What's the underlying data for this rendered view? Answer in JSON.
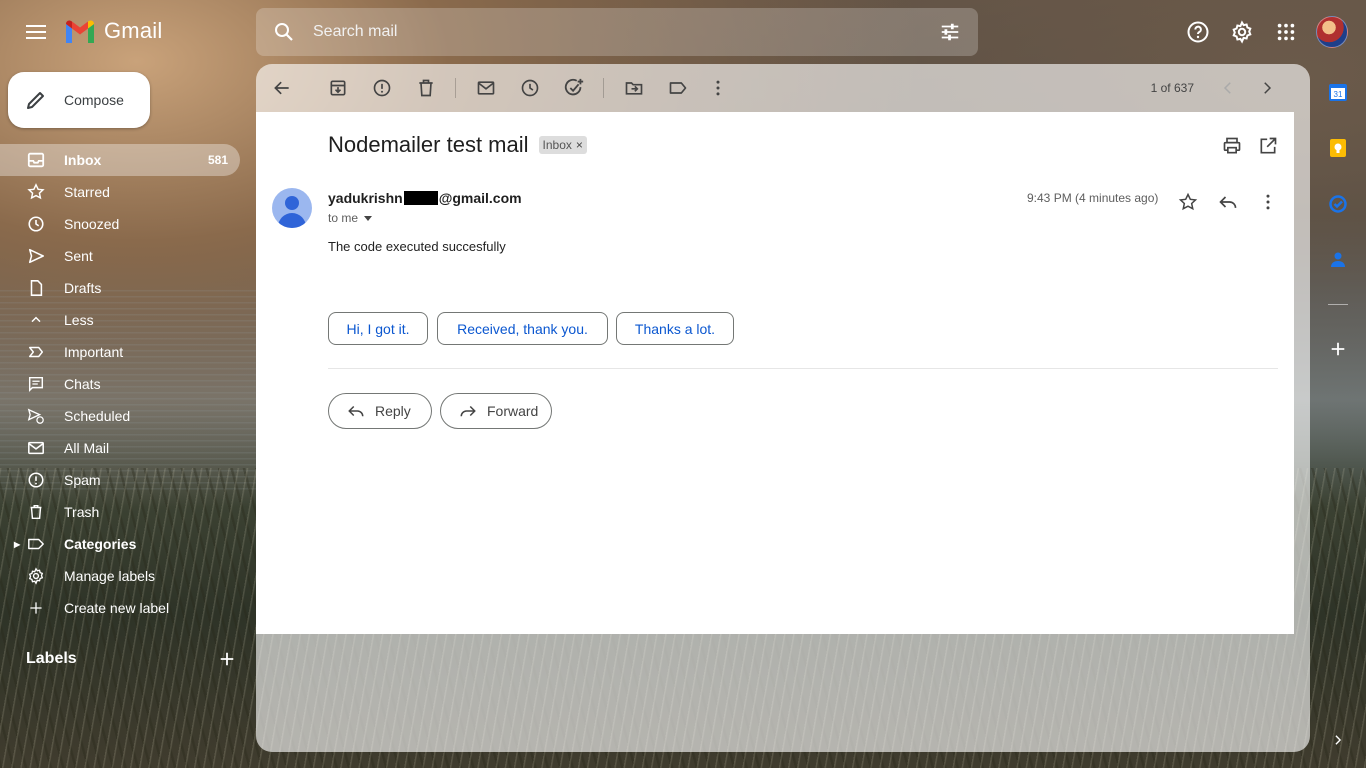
{
  "app": {
    "name": "Gmail"
  },
  "search": {
    "placeholder": "Search mail"
  },
  "sidebar": {
    "compose_label": "Compose",
    "items": [
      {
        "label": "Inbox",
        "count": "581"
      },
      {
        "label": "Starred"
      },
      {
        "label": "Snoozed"
      },
      {
        "label": "Sent"
      },
      {
        "label": "Drafts"
      },
      {
        "label": "Less"
      },
      {
        "label": "Important"
      },
      {
        "label": "Chats"
      },
      {
        "label": "Scheduled"
      },
      {
        "label": "All Mail"
      },
      {
        "label": "Spam"
      },
      {
        "label": "Trash"
      },
      {
        "label": "Categories"
      },
      {
        "label": "Manage labels"
      },
      {
        "label": "Create new label"
      }
    ],
    "labels_heading": "Labels"
  },
  "toolbar": {
    "pager": "1 of 637"
  },
  "email": {
    "subject": "Nodemailer test mail",
    "tag": "Inbox",
    "tag_close": "×",
    "sender_prefix": "yadukrishn",
    "sender_suffix": "@gmail.com",
    "to": "to me",
    "time": "9:43 PM (4 minutes ago)",
    "body": "The code executed succesfully",
    "smart_replies": [
      "Hi, I got it.",
      "Received, thank you.",
      "Thanks a lot."
    ],
    "reply_label": "Reply",
    "forward_label": "Forward"
  },
  "colors": {
    "accent": "#0b57d0",
    "calendar": "#1a73e8",
    "keep": "#fbbc04"
  }
}
